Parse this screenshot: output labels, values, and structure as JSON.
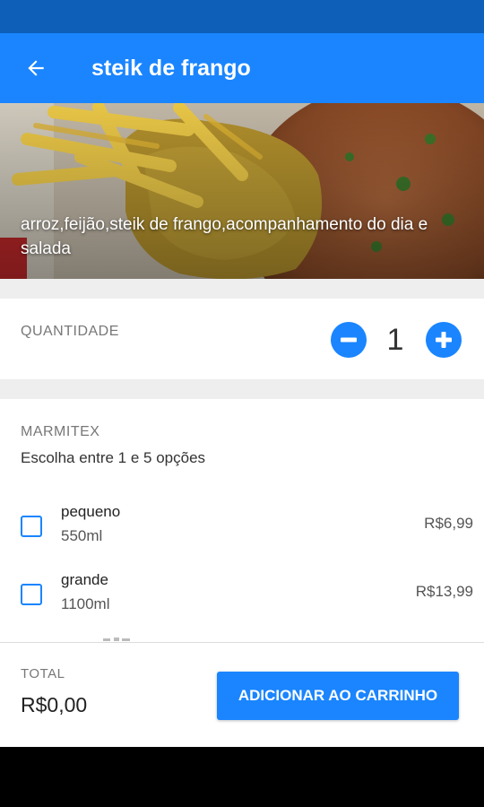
{
  "colors": {
    "primary": "#1a85ff",
    "status_bar": "#0d5fb8"
  },
  "app_bar": {
    "back_icon": "arrow-left-icon",
    "title": "steik de frango"
  },
  "hero": {
    "description": "arroz,feijão,steik de frango,acompanhamento do dia e salada"
  },
  "quantity": {
    "label": "QUANTIDADE",
    "value": "1",
    "decrement_icon": "minus-circle-icon",
    "increment_icon": "plus-circle-icon"
  },
  "options_section": {
    "title": "MARMITEX",
    "subtitle": "Escolha entre 1 e 5 opções",
    "items": [
      {
        "name": "pequeno",
        "desc": "550ml",
        "price": "R$6,99",
        "checked": false
      },
      {
        "name": "grande",
        "desc": "1100ml",
        "price": "R$13,99",
        "checked": false
      }
    ]
  },
  "footer": {
    "total_label": "TOTAL",
    "total_value": "R$0,00",
    "add_button": "ADICIONAR AO CARRINHO"
  }
}
